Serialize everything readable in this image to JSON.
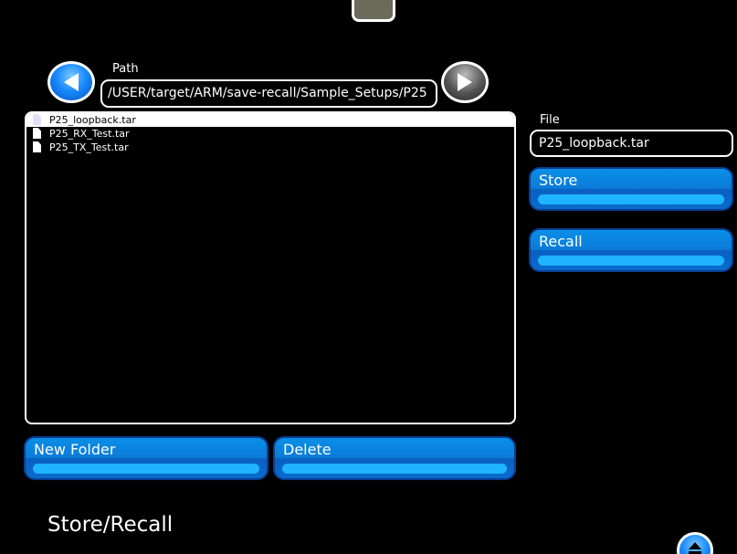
{
  "path": {
    "label": "Path",
    "value": "/USER/target/ARM/save-recall/Sample_Setups/P25"
  },
  "file_list": {
    "items": [
      {
        "name": "P25_loopback.tar",
        "selected": true
      },
      {
        "name": "P25_RX_Test.tar",
        "selected": false
      },
      {
        "name": "P25_TX_Test.tar",
        "selected": false
      }
    ]
  },
  "file": {
    "label": "File",
    "value": "P25_loopback.tar"
  },
  "buttons": {
    "store": "Store",
    "recall": "Recall",
    "new_folder": "New Folder",
    "delete": "Delete"
  },
  "page_title": "Store/Recall",
  "icons": {
    "back": "back-arrow-icon",
    "forward": "forward-arrow-icon",
    "collapse": "collapse-up-icon",
    "file": "document-icon"
  },
  "colors": {
    "background": "#000000",
    "button": "#0b7bd8",
    "button_highlight": "#1fb4ff",
    "accent_blue": "#1a8cff"
  }
}
